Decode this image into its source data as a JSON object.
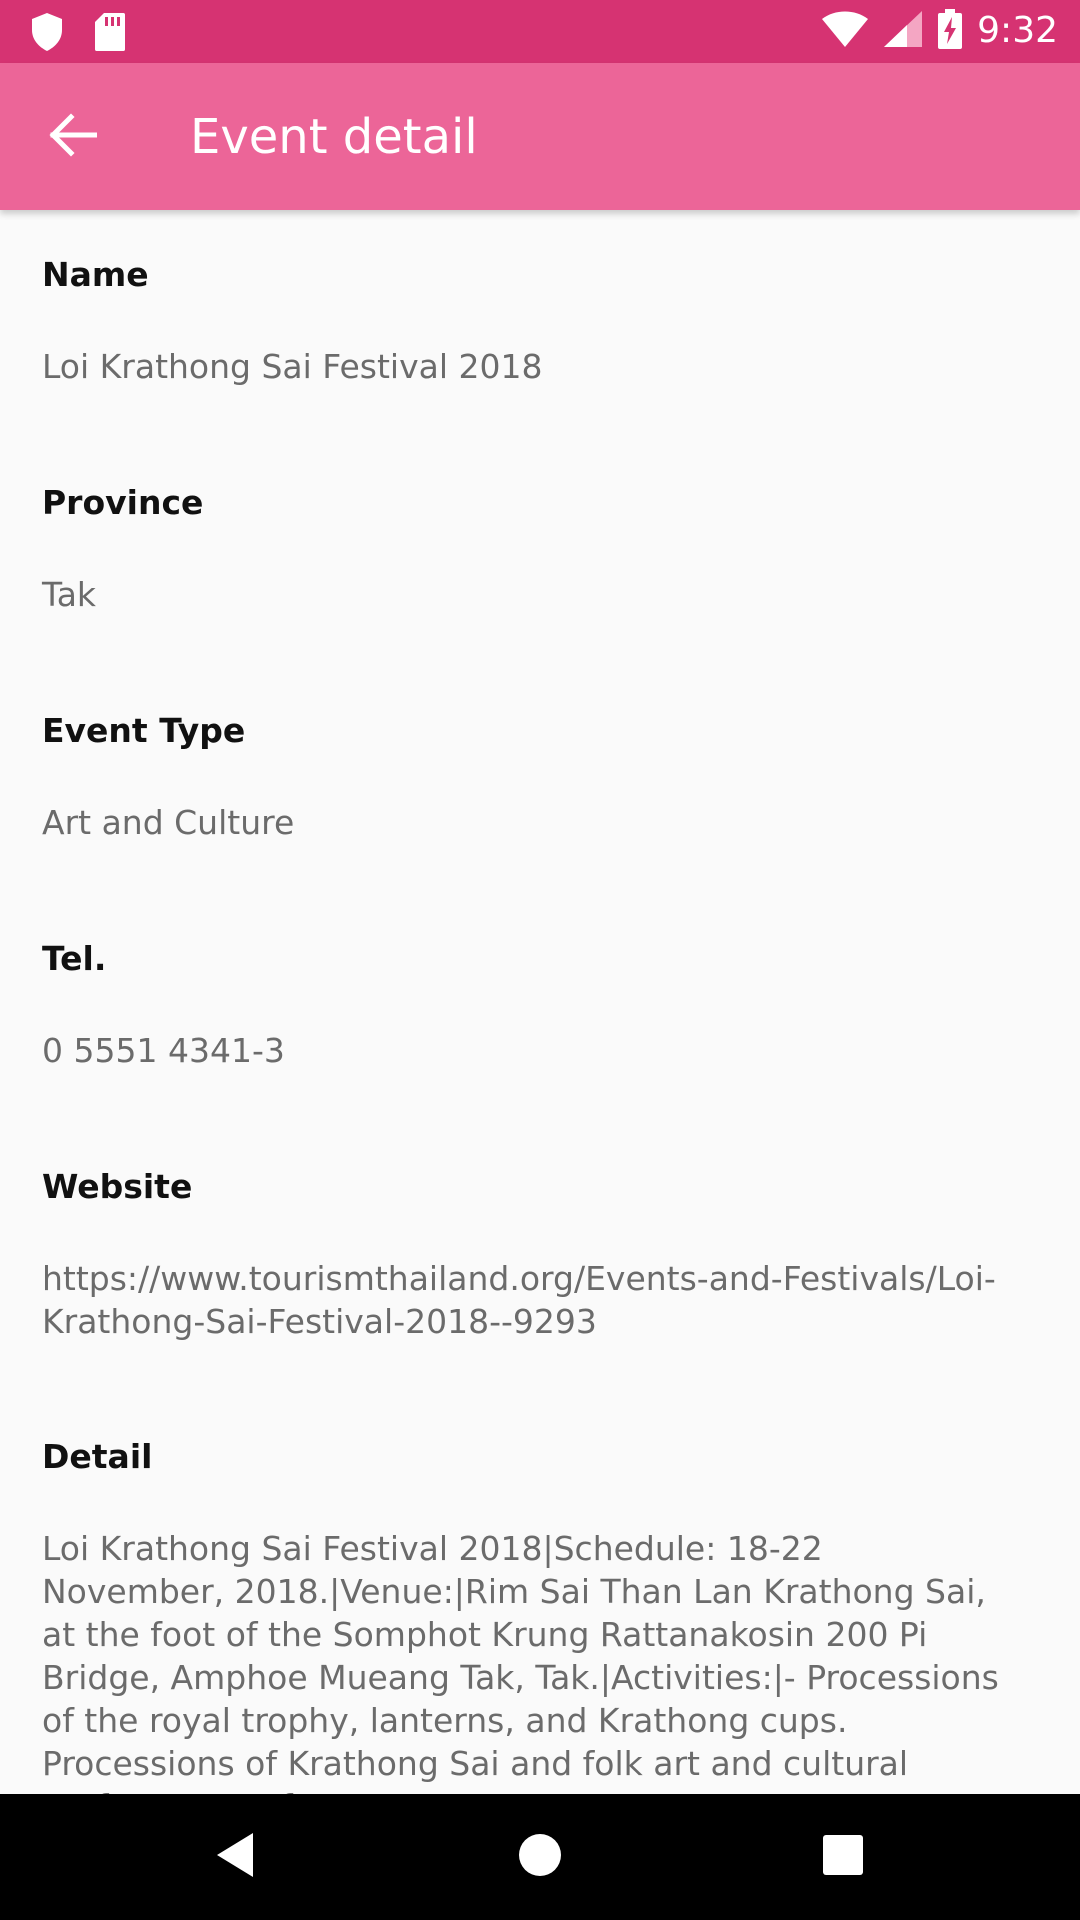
{
  "status_bar": {
    "time": "9:32",
    "icons": [
      "shield-icon",
      "sd-card-icon",
      "wifi-icon",
      "cellular-signal-icon",
      "battery-charging-icon"
    ]
  },
  "app_bar": {
    "title": "Event detail",
    "back_icon": "arrow-back-icon"
  },
  "fields": {
    "name": {
      "label": "Name",
      "value": "Loi Krathong Sai Festival 2018"
    },
    "province": {
      "label": "Province",
      "value": "Tak"
    },
    "event_type": {
      "label": "Event Type",
      "value": "Art and Culture"
    },
    "tel": {
      "label": "Tel.",
      "value": "0 5551 4341-3"
    },
    "website": {
      "label": "Website",
      "value": "https://www.tourismthailand.org/Events-and-Festivals/Loi-Krathong-Sai-Festival-2018--9293"
    },
    "detail": {
      "label": "Detail",
      "value": "Loi Krathong Sai Festival 2018|Schedule: 18-22 November, 2018.|Venue:|Rim Sai Than Lan Krathong Sai, at the foot of the Somphot Krung Rattanakosin 200 Pi Bridge, Amphoe Mueang Tak, Tak.|Activities:|- Processions of the royal trophy, lanterns, and Krathong cups. Processions of Krathong Sai and folk art and cultural performances from"
    }
  },
  "nav_bar": {
    "icons": [
      "back-triangle-icon",
      "home-circle-icon",
      "recents-square-icon"
    ]
  },
  "colors": {
    "status_bar": "#d63372",
    "app_bar": "#ec6598",
    "background": "#fafafa",
    "label": "#111111",
    "value": "#6b6b6b"
  }
}
